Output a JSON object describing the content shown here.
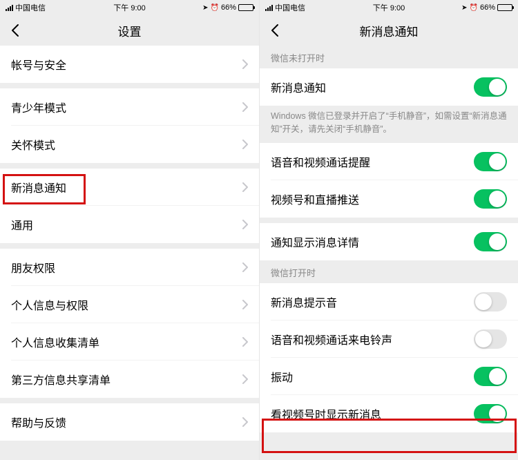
{
  "status": {
    "carrier": "中国电信",
    "time": "下午 9:00",
    "battery_text": "66%",
    "battery_pct": 66
  },
  "left": {
    "nav_title": "设置",
    "groups": [
      {
        "items": [
          {
            "label": "帐号与安全"
          }
        ]
      },
      {
        "items": [
          {
            "label": "青少年模式"
          },
          {
            "label": "关怀模式"
          }
        ]
      },
      {
        "items": [
          {
            "label": "新消息通知"
          },
          {
            "label": "通用"
          }
        ]
      },
      {
        "items": [
          {
            "label": "朋友权限"
          },
          {
            "label": "个人信息与权限"
          },
          {
            "label": "个人信息收集清单"
          },
          {
            "label": "第三方信息共享清单"
          }
        ]
      },
      {
        "items": [
          {
            "label": "帮助与反馈"
          }
        ]
      }
    ]
  },
  "right": {
    "nav_title": "新消息通知",
    "block1_header": "微信未打开时",
    "block1_items": [
      {
        "label": "新消息通知",
        "on": true
      }
    ],
    "block1_hint": "Windows 微信已登录并开启了“手机静音”，如需设置“新消息通知”开关，请先关闭“手机静音”。",
    "block2_items": [
      {
        "label": "语音和视频通话提醒",
        "on": true
      },
      {
        "label": "视频号和直播推送",
        "on": true
      }
    ],
    "block3_items": [
      {
        "label": "通知显示消息详情",
        "on": true
      }
    ],
    "block4_header": "微信打开时",
    "block4_items": [
      {
        "label": "新消息提示音",
        "on": false
      },
      {
        "label": "语音和视频通话来电铃声",
        "on": false
      },
      {
        "label": "振动",
        "on": true
      },
      {
        "label": "看视频号时显示新消息",
        "on": true
      }
    ]
  }
}
